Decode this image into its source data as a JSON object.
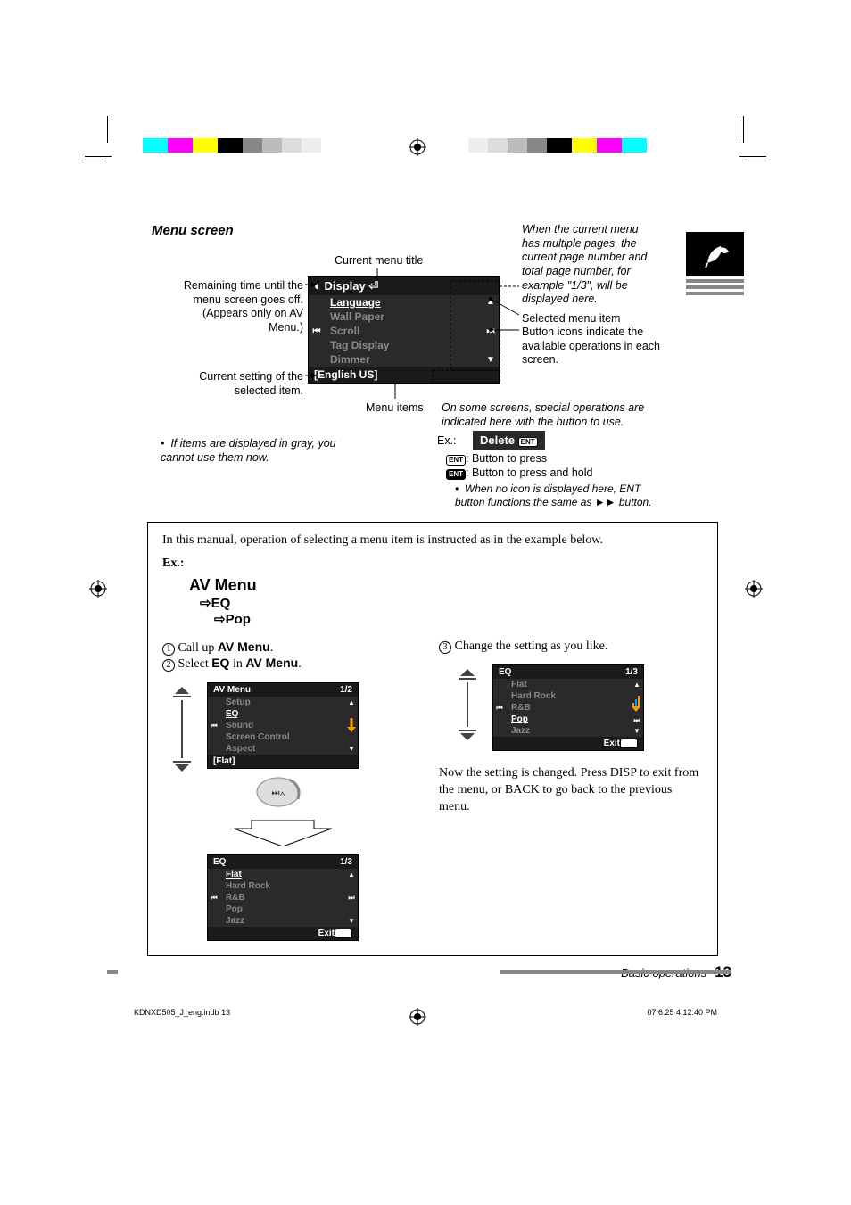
{
  "header": {
    "menuScreen": "Menu screen"
  },
  "callouts": {
    "currentMenuTitle": "Current menu title",
    "remaining1": "Remaining time until the",
    "remaining2": "menu screen goes off.",
    "remaining3": "(Appears only on AV Menu.)",
    "currentSetting1": "Current setting of the",
    "currentSetting2": "selected item.",
    "menuItems": "Menu items",
    "grayNote": "If items are displayed in gray, you cannot use them now.",
    "multiPage": "When the current menu has multiple pages, the current page number and total page number, for example \"1/3\", will be displayed here.",
    "selectedMenuItem": "Selected menu item",
    "buttonIcons": "Button icons indicate the available operations in each screen.",
    "specialOps": "On some screens, special operations are indicated here with the button to use.",
    "exLabel": "Ex.:",
    "deleteLabel": "Delete",
    "entPress": ": Button to press",
    "entHold": ": Button to press and hold",
    "noIconNote": "When no icon is displayed here, ENT button functions the same as ►► button."
  },
  "displayMenu": {
    "title": "Display",
    "items": [
      "Language",
      "Wall Paper",
      "Scroll",
      "Tag Display",
      "Dimmer"
    ],
    "setting": "[English US]"
  },
  "instructionBox": {
    "intro": "In this manual, operation of selecting a menu item is instructed as in the example below.",
    "exLabel": "Ex.:",
    "path1": "AV Menu",
    "path2": "EQ",
    "path3": "Pop",
    "step1a": "Call up ",
    "step1b": "AV Menu",
    "step1c": ".",
    "step2a": "Select ",
    "step2b": "EQ",
    "step2c": " in ",
    "step2d": "AV Menu",
    "step2e": ".",
    "step3": "Change the setting as you like.",
    "result": "Now the setting is changed. Press DISP to exit from the menu, or BACK to go back to the previous menu."
  },
  "avMenu": {
    "title": "AV Menu",
    "page": "1/2",
    "items": [
      "Setup",
      "EQ",
      "Sound",
      "Screen Control",
      "Aspect"
    ],
    "setting": "[Flat]"
  },
  "eqMenu": {
    "title": "EQ",
    "page": "1/3",
    "items": [
      "Flat",
      "Hard Rock",
      "R&B",
      "Pop",
      "Jazz"
    ],
    "exit": "Exit"
  },
  "eqMenu2": {
    "title": "EQ",
    "page": "1/3",
    "items": [
      "Flat",
      "Hard Rock",
      "R&B",
      "Pop",
      "Jazz"
    ],
    "exit": "Exit"
  },
  "footer": {
    "section": "Basic operations",
    "pageNum": "13",
    "indb": "KDNXD505_J_eng.indb   13",
    "timestamp": "07.6.25   4:12:40 PM"
  }
}
